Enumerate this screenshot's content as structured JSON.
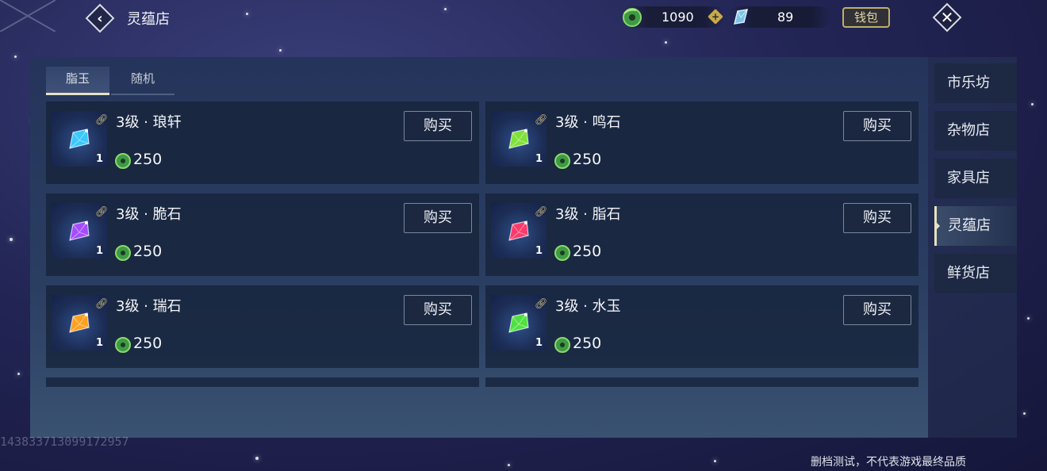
{
  "header": {
    "title": "灵蕴店",
    "back_icon": "chevron-left-icon",
    "close_icon": "close-icon"
  },
  "currencies": {
    "jade": {
      "icon": "jade-coin-icon",
      "value": "1090"
    },
    "crystal": {
      "icon": "crystal-icon",
      "value": "89"
    },
    "add_icon": "plus-icon",
    "wallet_label": "钱包"
  },
  "tabs": [
    {
      "label": "脂玉",
      "active": true
    },
    {
      "label": "随机",
      "active": false
    }
  ],
  "items": [
    {
      "name": "3级 · 琅轩",
      "price": "250",
      "qty": "1",
      "gem_color": "#38c8ff",
      "buy_label": "购买"
    },
    {
      "name": "3级 · 鸣石",
      "price": "250",
      "qty": "1",
      "gem_color": "#7fe03a",
      "buy_label": "购买"
    },
    {
      "name": "3级 · 脆石",
      "price": "250",
      "qty": "1",
      "gem_color": "#a64cff",
      "buy_label": "购买"
    },
    {
      "name": "3级 · 脂石",
      "price": "250",
      "qty": "1",
      "gem_color": "#ff3a6a",
      "buy_label": "购买"
    },
    {
      "name": "3级 · 瑞石",
      "price": "250",
      "qty": "1",
      "gem_color": "#ffa020",
      "buy_label": "购买"
    },
    {
      "name": "3级 · 水玉",
      "price": "250",
      "qty": "1",
      "gem_color": "#50e040",
      "buy_label": "购买"
    }
  ],
  "nav": [
    {
      "label": "市乐坊",
      "active": false
    },
    {
      "label": "杂物店",
      "active": false
    },
    {
      "label": "家具店",
      "active": false
    },
    {
      "label": "灵蕴店",
      "active": true
    },
    {
      "label": "鲜货店",
      "active": false
    }
  ],
  "footer": {
    "uid": "143833713099172957",
    "disclaimer": "删档测试，不代表游戏最终品质"
  }
}
